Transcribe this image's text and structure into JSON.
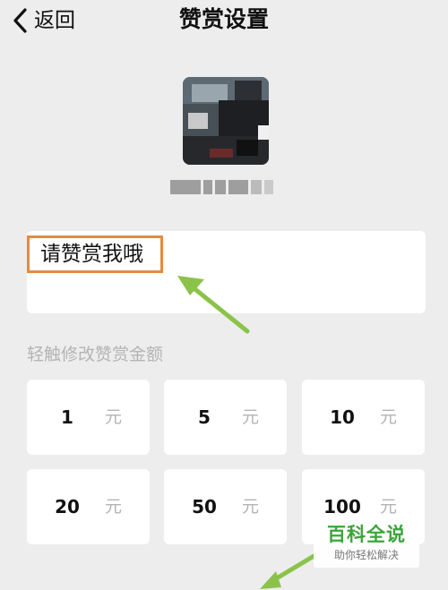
{
  "header": {
    "back_label": "返回",
    "title": "赞赏设置"
  },
  "profile": {
    "avatar_icon": "avatar-blurred",
    "nickname": ""
  },
  "message": {
    "value": "请赞赏我哦",
    "highlight_color": "#e9893a"
  },
  "amounts": {
    "hint": "轻触修改赞赏金额",
    "unit": "元",
    "items": [
      {
        "value": "1"
      },
      {
        "value": "5"
      },
      {
        "value": "10"
      },
      {
        "value": "20"
      },
      {
        "value": "50"
      },
      {
        "value": "100"
      }
    ]
  },
  "annotation": {
    "arrow_color": "#8bc34a"
  },
  "watermark": {
    "title": "百科全说",
    "subtitle": "助你轻松解决",
    "color": "#3aa53a"
  }
}
